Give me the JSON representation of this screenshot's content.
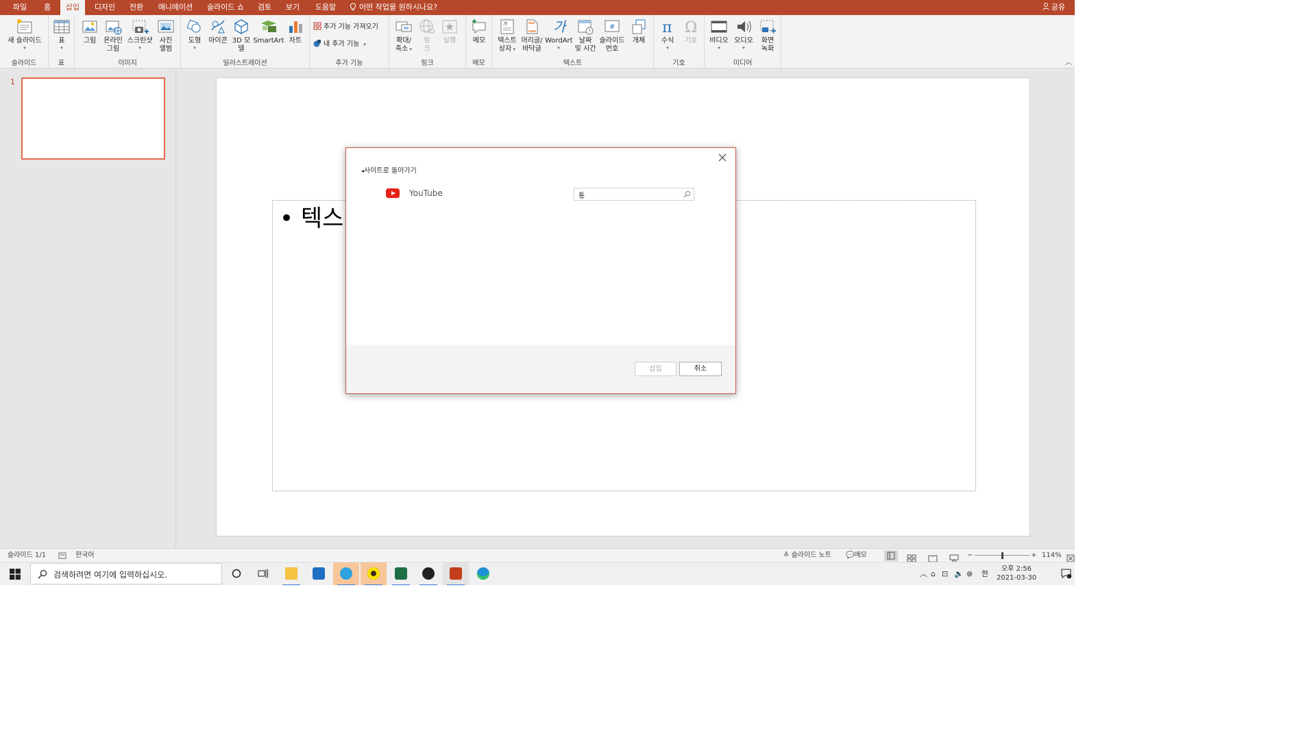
{
  "tabs": [
    "파일",
    "홈",
    "삽입",
    "디자인",
    "전환",
    "애니메이션",
    "슬라이드 쇼",
    "검토",
    "보기",
    "도움말"
  ],
  "active_tab": "삽입",
  "tell_me": "어떤 작업을 원하시나요?",
  "share": "공유",
  "ribbon": {
    "slides": {
      "group": "슬라이드",
      "new_slide": "새 슬라이드"
    },
    "tables": {
      "group": "표",
      "table": "표"
    },
    "images": {
      "group": "이미지",
      "picture": "그림",
      "online_picture_1": "온라인",
      "online_picture_2": "그림",
      "screenshot": "스크린샷",
      "album_1": "사진",
      "album_2": "앨범"
    },
    "illustrations": {
      "group": "일러스트레이션",
      "shapes": "도형",
      "icons": "아이콘",
      "model3d_1": "3D 모",
      "model3d_2": "델",
      "smartart": "SmartArt",
      "chart": "차트"
    },
    "addins": {
      "group": "추가 기능",
      "get_addins": "추가 기능 가져오기",
      "my_addins": "내 추가 기능"
    },
    "links": {
      "group": "링크",
      "zoom_1": "확대/",
      "zoom_2": "축소",
      "link_1": "링",
      "link_2": "크",
      "action": "실행"
    },
    "comments": {
      "group": "메모",
      "comment": "메모"
    },
    "text": {
      "group": "텍스트",
      "textbox_1": "텍스트",
      "textbox_2": "상자",
      "header_1": "머리글/",
      "header_2": "바닥글",
      "wordart": "WordArt",
      "datetime_1": "날짜",
      "datetime_2": "및 시간",
      "slidenum_1": "슬라이드",
      "slidenum_2": "번호",
      "object": "개체"
    },
    "symbols": {
      "group": "기호",
      "equation": "수식",
      "symbol": "기호"
    },
    "media": {
      "group": "미디어",
      "video": "비디오",
      "audio": "오디오",
      "record_1": "화면",
      "record_2": "녹화"
    }
  },
  "thumbnail_number": "1",
  "slide_text": "• 텍스",
  "dialog": {
    "back_link": "사이트로 돌아가기",
    "provider": "YouTube",
    "search_value": "통",
    "insert": "삽입",
    "cancel": "취소"
  },
  "status": {
    "slide_count": "슬라이드 1/1",
    "language": "한국어",
    "notes": "슬라이드 노트",
    "comments": "메모",
    "zoom": "114%"
  },
  "taskbar": {
    "search_placeholder": "검색하려면 여기에 입력하십시오.",
    "ime": "한",
    "time": "오후 2:56",
    "date": "2021-03-30"
  },
  "colors": {
    "accent": "#b7472a",
    "thumb_border": "#e0694a",
    "youtube": "#e62117"
  }
}
